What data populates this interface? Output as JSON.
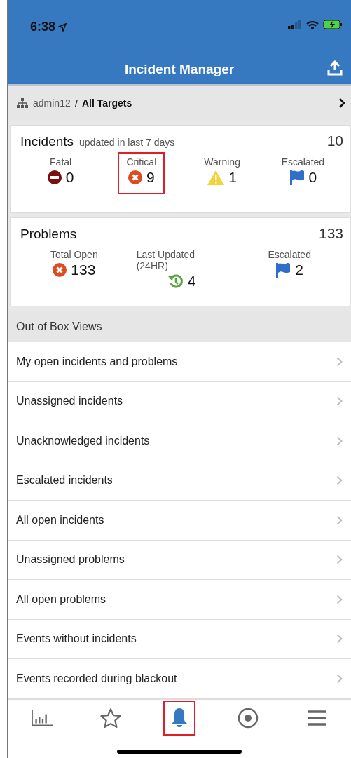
{
  "status_bar": {
    "time": "6:38"
  },
  "header": {
    "title": "Incident Manager"
  },
  "breadcrumb": {
    "user": "admin12",
    "separator": "/",
    "target": "All Targets"
  },
  "incidents": {
    "title": "Incidents",
    "subtitle": "updated in last 7 days",
    "total": "10",
    "stats": [
      {
        "label": "Fatal",
        "value": "0",
        "kind": "fatal",
        "highlighted": false
      },
      {
        "label": "Critical",
        "value": "9",
        "kind": "critical",
        "highlighted": true
      },
      {
        "label": "Warning",
        "value": "1",
        "kind": "warning",
        "highlighted": false
      },
      {
        "label": "Escalated",
        "value": "0",
        "kind": "escalated",
        "highlighted": false
      }
    ]
  },
  "problems": {
    "title": "Problems",
    "total": "133",
    "stats": [
      {
        "label": "Total Open",
        "value": "133",
        "kind": "critical",
        "highlighted": false
      },
      {
        "label": "Last Updated (24HR)",
        "value": "4",
        "kind": "history",
        "highlighted": false
      },
      {
        "label": "Escalated",
        "value": "2",
        "kind": "escalated",
        "highlighted": false
      }
    ]
  },
  "views": {
    "title": "Out of Box Views",
    "items": [
      "My open incidents and problems",
      "Unassigned incidents",
      "Unacknowledged incidents",
      "Escalated incidents",
      "All open incidents",
      "Unassigned problems",
      "All open problems",
      "Events without incidents",
      "Events recorded during blackout"
    ]
  },
  "tab_bar": [
    {
      "kind": "chart",
      "selected": false,
      "highlighted": false
    },
    {
      "kind": "star",
      "selected": false,
      "highlighted": false
    },
    {
      "kind": "bell",
      "selected": true,
      "highlighted": true
    },
    {
      "kind": "target",
      "selected": false,
      "highlighted": false
    },
    {
      "kind": "menu",
      "selected": false,
      "highlighted": false
    }
  ]
}
